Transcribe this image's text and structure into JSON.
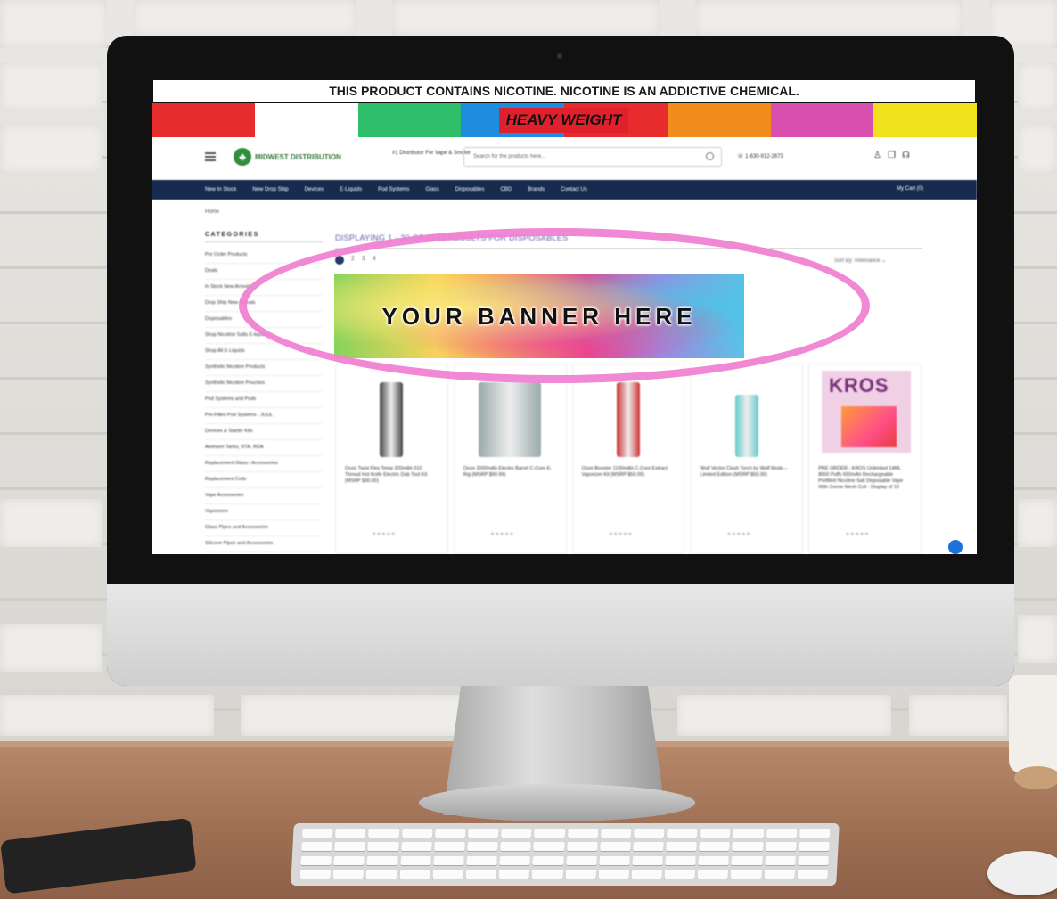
{
  "screen": {
    "warning_banner": "THIS PRODUCT CONTAINS NICOTINE. NICOTINE IS AN ADDICTIVE CHEMICAL.",
    "promo_label": "HEAVY WEIGHT",
    "promo_colors": [
      "#e62c2c",
      "#ffffff",
      "#2fbf6a",
      "#1e8de0",
      "#e62c2c",
      "#f28c1c",
      "#d94fb0",
      "#f0e21a"
    ],
    "header": {
      "logo_text": "MIDWEST DISTRIBUTION",
      "tagline": "#1 Distributor For Vape & Smoke",
      "search_placeholder": "Search for the products here...",
      "phone": "1-630-912-2673"
    },
    "nav": {
      "items": [
        "New In Stock",
        "New Drop Ship",
        "Devices",
        "E-Liquids",
        "Pod Systems",
        "Glass",
        "Disposables",
        "CBD",
        "Brands",
        "Contact Us"
      ],
      "cart": "My Cart (0)"
    },
    "breadcrumb": "Home",
    "sidebar": {
      "title": "CATEGORIES",
      "items": [
        "Pre Order Products",
        "Deals",
        "In Stock New Arrivals",
        "Drop Ship New Arrivals",
        "Disposables",
        "Shop Nicotine Salts E-liquids",
        "Shop All E-Liquids",
        "Synthetic Nicotine Products",
        "Synthetic Nicotine Pouches",
        "Pod Systems and Pods",
        "Pre-Filled Pod Systems - JUUL",
        "Devices & Starter Kits",
        "Atomizer Tanks, RTA, RDA",
        "Replacement Glass / Accessories",
        "Replacement Coils",
        "Vape Accessories",
        "Vaporizers",
        "Glass Pipes and Accessories",
        "Silicone Pipes and Accessories"
      ]
    },
    "main": {
      "title": "DISPLAYING 1 - 30 OF 5543 RESULTS FOR DISPOSABLES",
      "pages": [
        "1",
        "2",
        "3",
        "4"
      ],
      "sort_label": "Sort By:",
      "sort_value": "Relevance",
      "banner_text": "YOUR BANNER HERE"
    },
    "products": [
      {
        "name": "Ooze Twist Flex Temp 320mAh 510 Thread Hot Knife Electric Dab Tool Kit (MSRP $30.00)",
        "rating": "★★★★★"
      },
      {
        "name": "Ooze 2000mAh Electro Barrel C-Core E-Rig (MSRP $99.99)",
        "rating": "★★★★★"
      },
      {
        "name": "Ooze Booster 1100mAh C-Core Extract Vaporizer Kit (MSRP $50.00)",
        "rating": "★★★★★"
      },
      {
        "name": "Wulf Vector Clash Torch by Wulf Mods – Limited Edition (MSRP $50.00)",
        "rating": "★★★★★"
      },
      {
        "name": "PRE ORDER - KROS Unlimited 14ML 8000 Puffs 650mAh Rechargeable Prefilled Nicotine Salt Disposable Vape With Comix Mesh Coil - Display of 10",
        "rating": "★★★★★"
      }
    ],
    "kros_logo": "KROS"
  }
}
